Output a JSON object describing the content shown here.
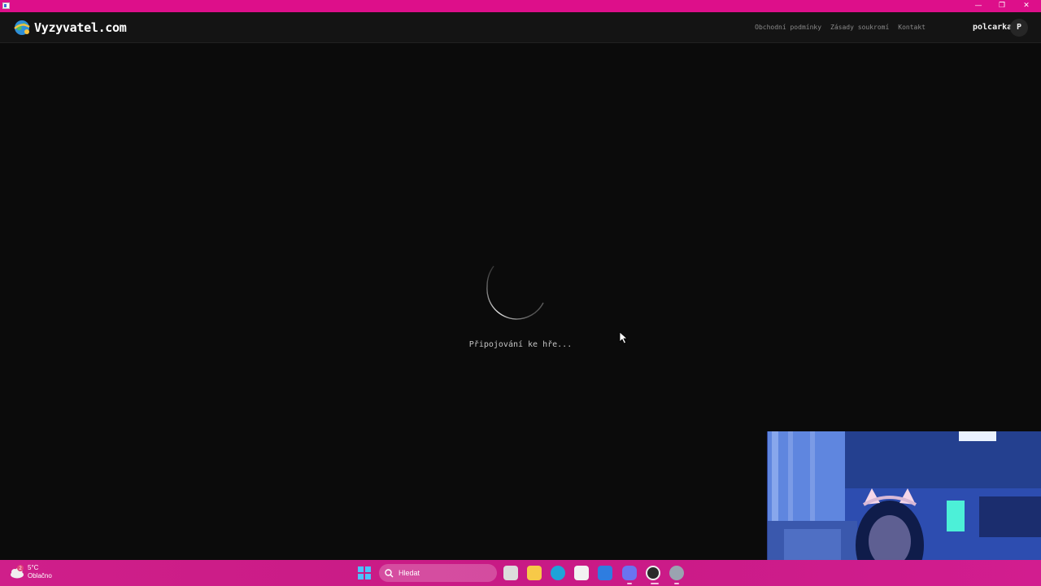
{
  "window": {
    "title_controls": {
      "minimize": "—",
      "maximize": "❐",
      "close": "✕"
    }
  },
  "header": {
    "logo_text": "Vyzyvatel.com",
    "nav": [
      {
        "label": "Obchodní podmínky"
      },
      {
        "label": "Zásady soukromí"
      },
      {
        "label": "Kontakt"
      }
    ],
    "username": "polcarka",
    "avatar_initial": "P"
  },
  "main": {
    "loading_text": "Připojování ke hře..."
  },
  "taskbar": {
    "weather": {
      "temp": "5°C",
      "condition": "Oblačno",
      "badge": "2"
    },
    "search_placeholder": "Hledat",
    "apps": [
      {
        "name": "task-view",
        "color": "#e6e6e6"
      },
      {
        "name": "file-explorer",
        "color": "#f7c948"
      },
      {
        "name": "edge",
        "color": "#1fa3d8"
      },
      {
        "name": "microsoft-store",
        "color": "#f2f2f2"
      },
      {
        "name": "mail",
        "color": "#2e7de0"
      },
      {
        "name": "discord",
        "color": "#6a74f0"
      },
      {
        "name": "obs",
        "color": "#2a2a2a"
      },
      {
        "name": "settings",
        "color": "#9aa3b0"
      }
    ]
  },
  "colors": {
    "accent": "#dd0f8a",
    "background": "#0b0b0b",
    "header_bg": "#141414",
    "taskbar": "#cf1f8a"
  }
}
